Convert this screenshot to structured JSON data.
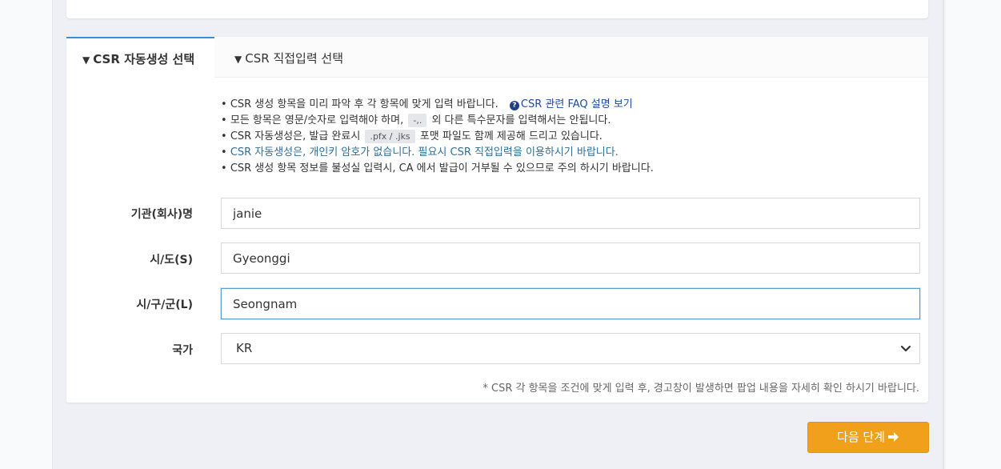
{
  "tabs": {
    "auto": "CSR 자동생성 선택",
    "manual": "CSR 직접입력 선택"
  },
  "notes": {
    "line1": "CSR 생성 항목을 미리 파악 후 각 항목에 맞게 입력 바랍니다.",
    "faq_link": "CSR 관련 FAQ 설명 보기",
    "line2_pre": "모든 항목은 영문/숫자로 입력해야 하며,",
    "line2_code": "-,.",
    "line2_post": "외 다른 특수문자를 입력해서는 안됩니다.",
    "line3_pre": "CSR 자동생성은, 발급 완료시",
    "line3_code": ".pfx / .jks",
    "line3_post": "포맷 파일도 함께 제공해 드리고 있습니다.",
    "line4": "CSR 자동생성은, 개인키 암호가 없습니다. 필요시 CSR 직접입력을 이용하시기 바랍니다.",
    "line5": "CSR 생성 항목 정보를 불성실 입력시, CA 에서 발급이 거부될 수 있으므로 주의 하시기 바랍니다."
  },
  "form": {
    "org_label": "기관(회사)명",
    "org_value": "janie",
    "state_label": "시/도(S)",
    "state_value": "Gyeonggi",
    "city_label": "시/구/군(L)",
    "city_value": "Seongnam",
    "country_label": "국가",
    "country_value": "KR"
  },
  "hint": "* CSR 각 항목을 조건에 맞게 입력 후, 경고창이 발생하면 팝업 내용을 자세히 확인 하시기 바랍니다.",
  "next_button": "다음 단계",
  "colors": {
    "accent": "#f0a01a",
    "tab_active_border": "#3b8fd6",
    "link": "#1f4aa0",
    "note_blue": "#2f6e99"
  }
}
